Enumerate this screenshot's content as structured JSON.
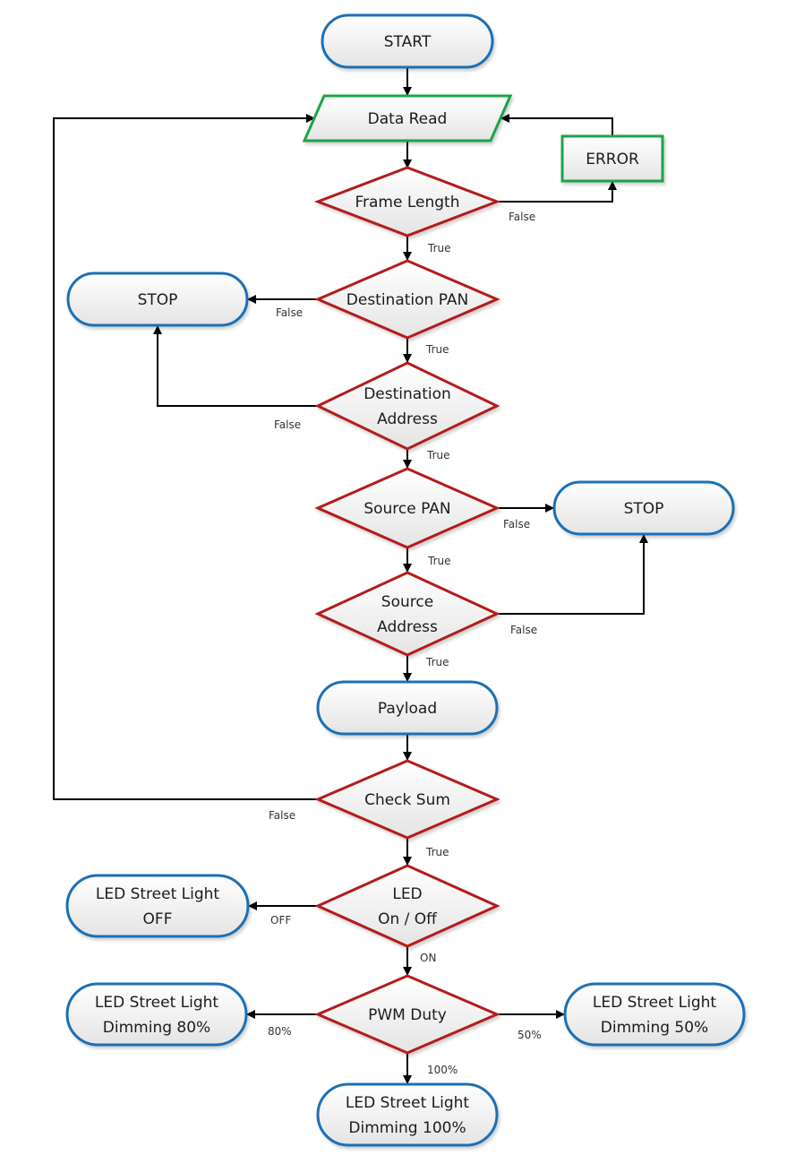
{
  "colors": {
    "terminal_stroke": "#1f6fb4",
    "io_stroke": "#1aa34a",
    "decision_stroke": "#b31b1b",
    "fill_top": "#ffffff",
    "fill_bottom": "#e6e6e6",
    "edge": "#000000"
  },
  "nodes": {
    "start": {
      "type": "terminal",
      "lines": [
        "START"
      ]
    },
    "data_read": {
      "type": "io",
      "lines": [
        "Data Read"
      ]
    },
    "error": {
      "type": "process",
      "lines": [
        "ERROR"
      ]
    },
    "frame_length": {
      "type": "decision",
      "lines": [
        "Frame Length"
      ]
    },
    "stop_left": {
      "type": "terminal",
      "lines": [
        "STOP"
      ]
    },
    "destination_pan": {
      "type": "decision",
      "lines": [
        "Destination PAN"
      ]
    },
    "destination_address": {
      "type": "decision",
      "lines": [
        "Destination",
        "Address"
      ]
    },
    "source_pan": {
      "type": "decision",
      "lines": [
        "Source PAN"
      ]
    },
    "stop_right": {
      "type": "terminal",
      "lines": [
        "STOP"
      ]
    },
    "source_address": {
      "type": "decision",
      "lines": [
        "Source",
        "Address"
      ]
    },
    "payload": {
      "type": "terminal",
      "lines": [
        "Payload"
      ]
    },
    "check_sum": {
      "type": "decision",
      "lines": [
        "Check Sum"
      ]
    },
    "led_on_off": {
      "type": "decision",
      "lines": [
        "LED",
        "On / Off"
      ]
    },
    "led_off": {
      "type": "terminal",
      "lines": [
        "LED Street Light",
        "OFF"
      ]
    },
    "pwm_duty": {
      "type": "decision",
      "lines": [
        "PWM Duty"
      ]
    },
    "dim_80": {
      "type": "terminal",
      "lines": [
        "LED Street Light",
        "Dimming 80%"
      ]
    },
    "dim_50": {
      "type": "terminal",
      "lines": [
        "LED Street Light",
        "Dimming 50%"
      ]
    },
    "dim_100": {
      "type": "terminal",
      "lines": [
        "LED Street Light",
        "Dimming 100%"
      ]
    }
  },
  "edges": [
    {
      "from": "start",
      "to": "data_read",
      "label": ""
    },
    {
      "from": "data_read",
      "to": "frame_length",
      "label": ""
    },
    {
      "from": "frame_length",
      "to": "error",
      "label": "False"
    },
    {
      "from": "error",
      "to": "data_read",
      "label": ""
    },
    {
      "from": "frame_length",
      "to": "destination_pan",
      "label": "True"
    },
    {
      "from": "destination_pan",
      "to": "stop_left",
      "label": "False"
    },
    {
      "from": "destination_pan",
      "to": "destination_address",
      "label": "True"
    },
    {
      "from": "destination_address",
      "to": "stop_left",
      "label": "False"
    },
    {
      "from": "destination_address",
      "to": "source_pan",
      "label": "True"
    },
    {
      "from": "source_pan",
      "to": "stop_right",
      "label": "False"
    },
    {
      "from": "source_pan",
      "to": "source_address",
      "label": "True"
    },
    {
      "from": "source_address",
      "to": "stop_right",
      "label": "False"
    },
    {
      "from": "source_address",
      "to": "payload",
      "label": "True"
    },
    {
      "from": "payload",
      "to": "check_sum",
      "label": ""
    },
    {
      "from": "check_sum",
      "to": "data_read",
      "label": "False"
    },
    {
      "from": "check_sum",
      "to": "led_on_off",
      "label": "True"
    },
    {
      "from": "led_on_off",
      "to": "led_off",
      "label": "OFF"
    },
    {
      "from": "led_on_off",
      "to": "pwm_duty",
      "label": "ON"
    },
    {
      "from": "pwm_duty",
      "to": "dim_80",
      "label": "80%"
    },
    {
      "from": "pwm_duty",
      "to": "dim_50",
      "label": "50%"
    },
    {
      "from": "pwm_duty",
      "to": "dim_100",
      "label": "100%"
    }
  ]
}
